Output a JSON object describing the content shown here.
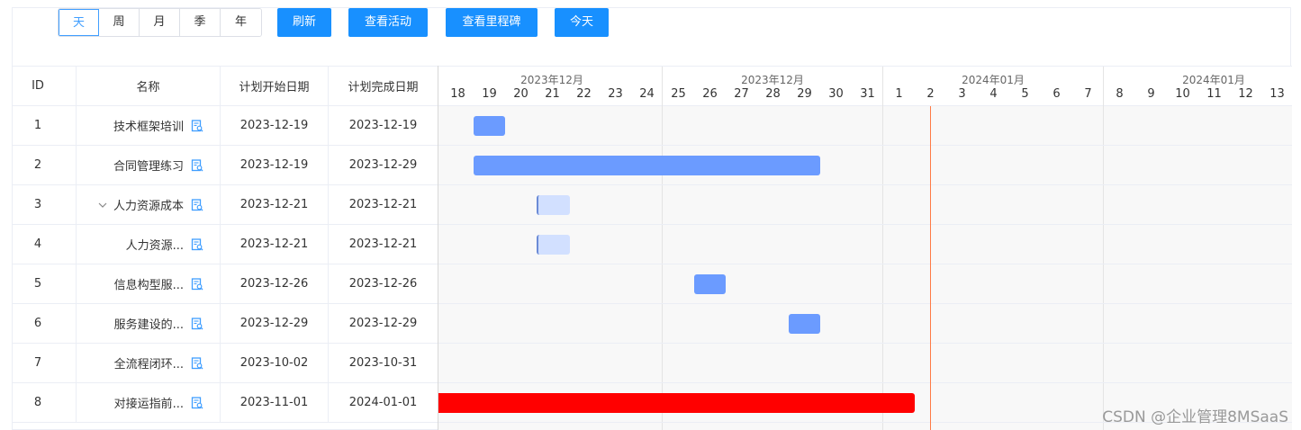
{
  "toolbar": {
    "view_options": [
      "天",
      "周",
      "月",
      "季",
      "年"
    ],
    "active_view": "天",
    "buttons": [
      "刷新",
      "查看活动",
      "查看里程碑",
      "今天"
    ]
  },
  "table": {
    "headers": [
      "ID",
      "名称",
      "计划开始日期",
      "计划完成日期"
    ],
    "rows": [
      {
        "id": "1",
        "name": "技术框架培训",
        "start": "2023-12-19",
        "end": "2023-12-19",
        "expandable": false
      },
      {
        "id": "2",
        "name": "合同管理练习",
        "start": "2023-12-19",
        "end": "2023-12-29",
        "expandable": false
      },
      {
        "id": "3",
        "name": "人力资源成本",
        "start": "2023-12-21",
        "end": "2023-12-21",
        "expandable": true
      },
      {
        "id": "4",
        "name": "人力资源...",
        "start": "2023-12-21",
        "end": "2023-12-21",
        "expandable": false
      },
      {
        "id": "5",
        "name": "信息构型服...",
        "start": "2023-12-26",
        "end": "2023-12-26",
        "expandable": false
      },
      {
        "id": "6",
        "name": "服务建设的...",
        "start": "2023-12-29",
        "end": "2023-12-29",
        "expandable": false
      },
      {
        "id": "7",
        "name": "全流程闭环...",
        "start": "2023-10-02",
        "end": "2023-10-31",
        "expandable": false
      },
      {
        "id": "8",
        "name": "对接运指前...",
        "start": "2023-11-01",
        "end": "2024-01-01",
        "expandable": false
      }
    ]
  },
  "gantt": {
    "months": [
      "2023年12月",
      "2023年12月",
      "2024年01月",
      "2024年01月"
    ],
    "days": [
      "18",
      "19",
      "20",
      "21",
      "22",
      "23",
      "24",
      "25",
      "26",
      "27",
      "28",
      "29",
      "30",
      "31",
      "1",
      "2",
      "3",
      "4",
      "5",
      "6",
      "7",
      "8",
      "9",
      "10",
      "11",
      "12",
      "13"
    ],
    "today_marker": "2024-01-02",
    "colors": {
      "bar": "#6b9bff",
      "bar_light": "#d2e0ff",
      "overdue": "#ff0000",
      "today": "#ff7a45",
      "primary": "#1890ff"
    }
  },
  "watermark": "CSDN @企业管理8MSaaS"
}
